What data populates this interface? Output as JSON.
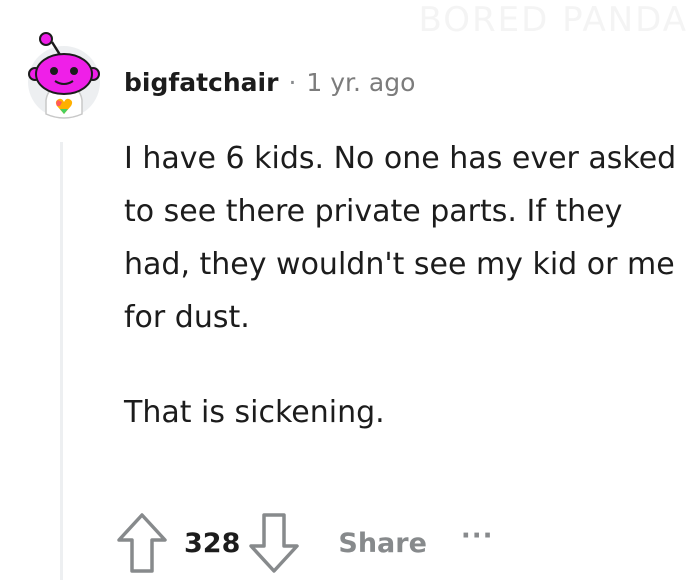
{
  "watermark": "BORED PANDA",
  "comment": {
    "username": "bigfatchair",
    "separator": "·",
    "timestamp": "1 yr. ago",
    "paragraphs": [
      "I have 6 kids. No one has ever asked to see there private parts. If they had, they wouldn't see my kid or me for dust.",
      "That is sickening."
    ],
    "score": "328",
    "share_label": "Share",
    "more_label": "···"
  },
  "icons": {
    "avatar": "snoo-avatar-icon",
    "upvote": "arrow-up-icon",
    "downvote": "arrow-down-icon",
    "more": "more-options-icon"
  },
  "colors": {
    "avatar_head": "#ef1fe8",
    "avatar_background": "#edeff1",
    "text": "#1c1c1c",
    "muted": "#878a8c",
    "thread_line": "#edeff1"
  }
}
